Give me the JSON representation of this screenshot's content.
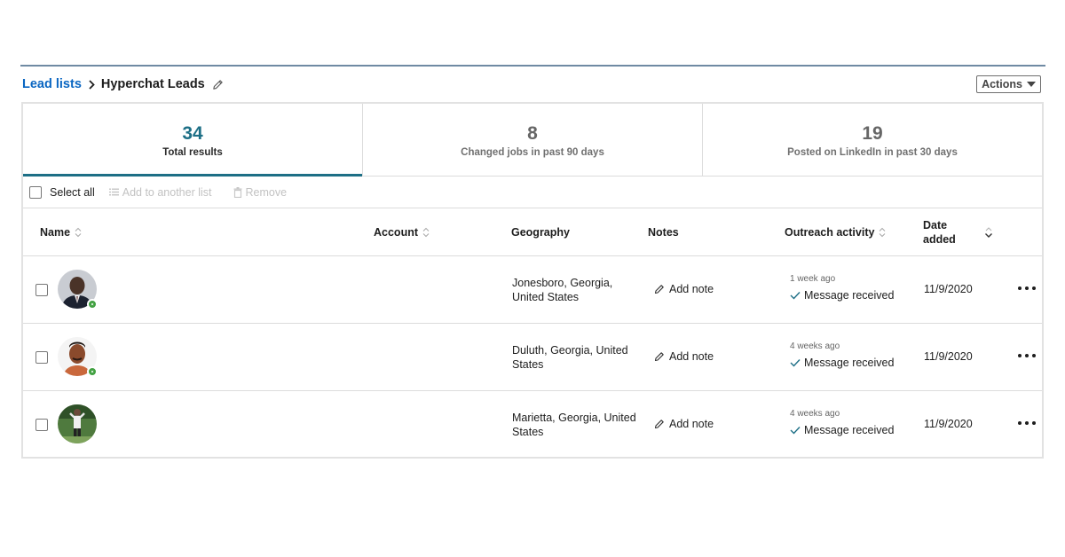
{
  "breadcrumb": {
    "parent": "Lead lists",
    "current": "Hyperchat Leads"
  },
  "actions": {
    "label": "Actions"
  },
  "stats": [
    {
      "number": "34",
      "label": "Total results",
      "active": true
    },
    {
      "number": "8",
      "label": "Changed jobs in past 90 days",
      "active": false
    },
    {
      "number": "19",
      "label": "Posted on LinkedIn in past 30 days",
      "active": false
    }
  ],
  "toolbar": {
    "select_all": "Select all",
    "add_to_list": "Add to another list",
    "remove": "Remove"
  },
  "columns": {
    "name": "Name",
    "account": "Account",
    "geography": "Geography",
    "notes": "Notes",
    "outreach": "Outreach activity",
    "date_line1": "Date",
    "date_line2": "added"
  },
  "rows": [
    {
      "geography": "Jonesboro, Georgia, United States",
      "note": "Add note",
      "outreach_time": "1 week ago",
      "outreach_status": "Message received",
      "date": "11/9/2020",
      "online": true
    },
    {
      "geography": "Duluth, Georgia, United States",
      "note": "Add note",
      "outreach_time": "4 weeks ago",
      "outreach_status": "Message received",
      "date": "11/9/2020",
      "online": true
    },
    {
      "geography": "Marietta, Georgia, United States",
      "note": "Add note",
      "outreach_time": "4 weeks ago",
      "outreach_status": "Message received",
      "date": "11/9/2020",
      "online": false
    }
  ],
  "colors": {
    "link": "#0a66c2",
    "active_tab": "#1d6f86",
    "check": "#1d6f86",
    "presence": "#40a040"
  }
}
